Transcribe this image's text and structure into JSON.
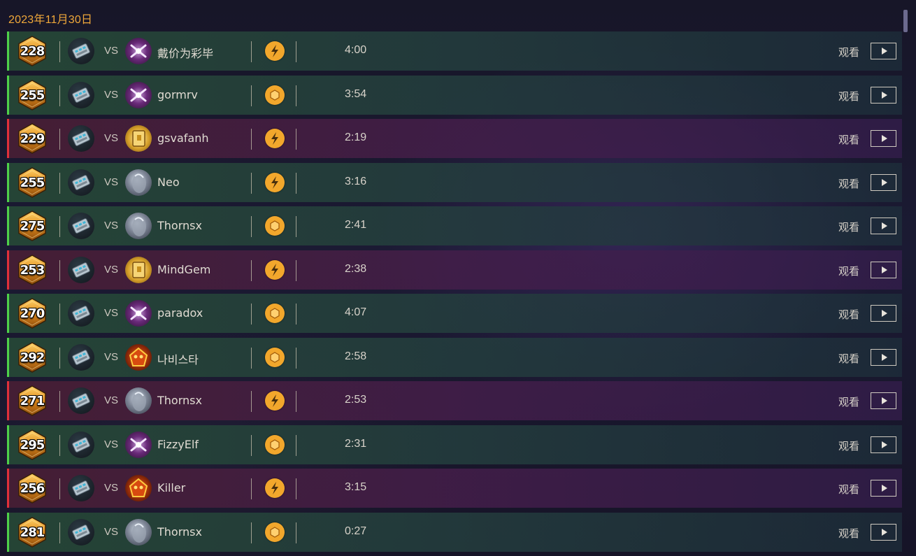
{
  "header": {
    "date": "2023年11月30日"
  },
  "labels": {
    "vs": "VS",
    "watch": "观看"
  },
  "colors": {
    "win_bar": "#4fd14a",
    "loss_bar": "#e0303a",
    "accent": "#f0a83a",
    "mode_icon": "#f2a72c"
  },
  "matches": [
    {
      "rating": "228",
      "result": "win",
      "opponent": "戴价为彩毕",
      "opponent_icon": "arcane-icon",
      "mode_icon": "bolt-icon",
      "duration": "4:00"
    },
    {
      "rating": "255",
      "result": "win",
      "opponent": "gormrv",
      "opponent_icon": "arcane-icon",
      "mode_icon": "hexagon-icon",
      "duration": "3:54"
    },
    {
      "rating": "229",
      "result": "loss",
      "opponent": "gsvafanh",
      "opponent_icon": "tome-icon",
      "mode_icon": "bolt-icon",
      "duration": "2:19"
    },
    {
      "rating": "255",
      "result": "win",
      "opponent": "Neo",
      "opponent_icon": "ghost-icon",
      "mode_icon": "bolt-icon",
      "duration": "3:16"
    },
    {
      "rating": "275",
      "result": "win",
      "opponent": "Thornsx",
      "opponent_icon": "ghost-icon",
      "mode_icon": "hexagon-icon",
      "duration": "2:41"
    },
    {
      "rating": "253",
      "result": "loss",
      "opponent": "MindGem",
      "opponent_icon": "tome-icon",
      "mode_icon": "bolt-icon",
      "duration": "2:38"
    },
    {
      "rating": "270",
      "result": "win",
      "opponent": "paradox",
      "opponent_icon": "arcane-icon",
      "mode_icon": "hexagon-icon",
      "duration": "4:07"
    },
    {
      "rating": "292",
      "result": "win",
      "opponent": "나비스타",
      "opponent_icon": "demon-icon",
      "mode_icon": "hexagon-icon",
      "duration": "2:58"
    },
    {
      "rating": "271",
      "result": "loss",
      "opponent": "Thornsx",
      "opponent_icon": "ghost-icon",
      "mode_icon": "bolt-icon",
      "duration": "2:53"
    },
    {
      "rating": "295",
      "result": "win",
      "opponent": "FizzyElf",
      "opponent_icon": "arcane-icon",
      "mode_icon": "hexagon-icon",
      "duration": "2:31"
    },
    {
      "rating": "256",
      "result": "loss",
      "opponent": "Killer",
      "opponent_icon": "demon-icon",
      "mode_icon": "bolt-icon",
      "duration": "3:15"
    },
    {
      "rating": "281",
      "result": "win",
      "opponent": "Thornsx",
      "opponent_icon": "ghost-icon",
      "mode_icon": "hexagon-icon",
      "duration": "0:27"
    }
  ]
}
